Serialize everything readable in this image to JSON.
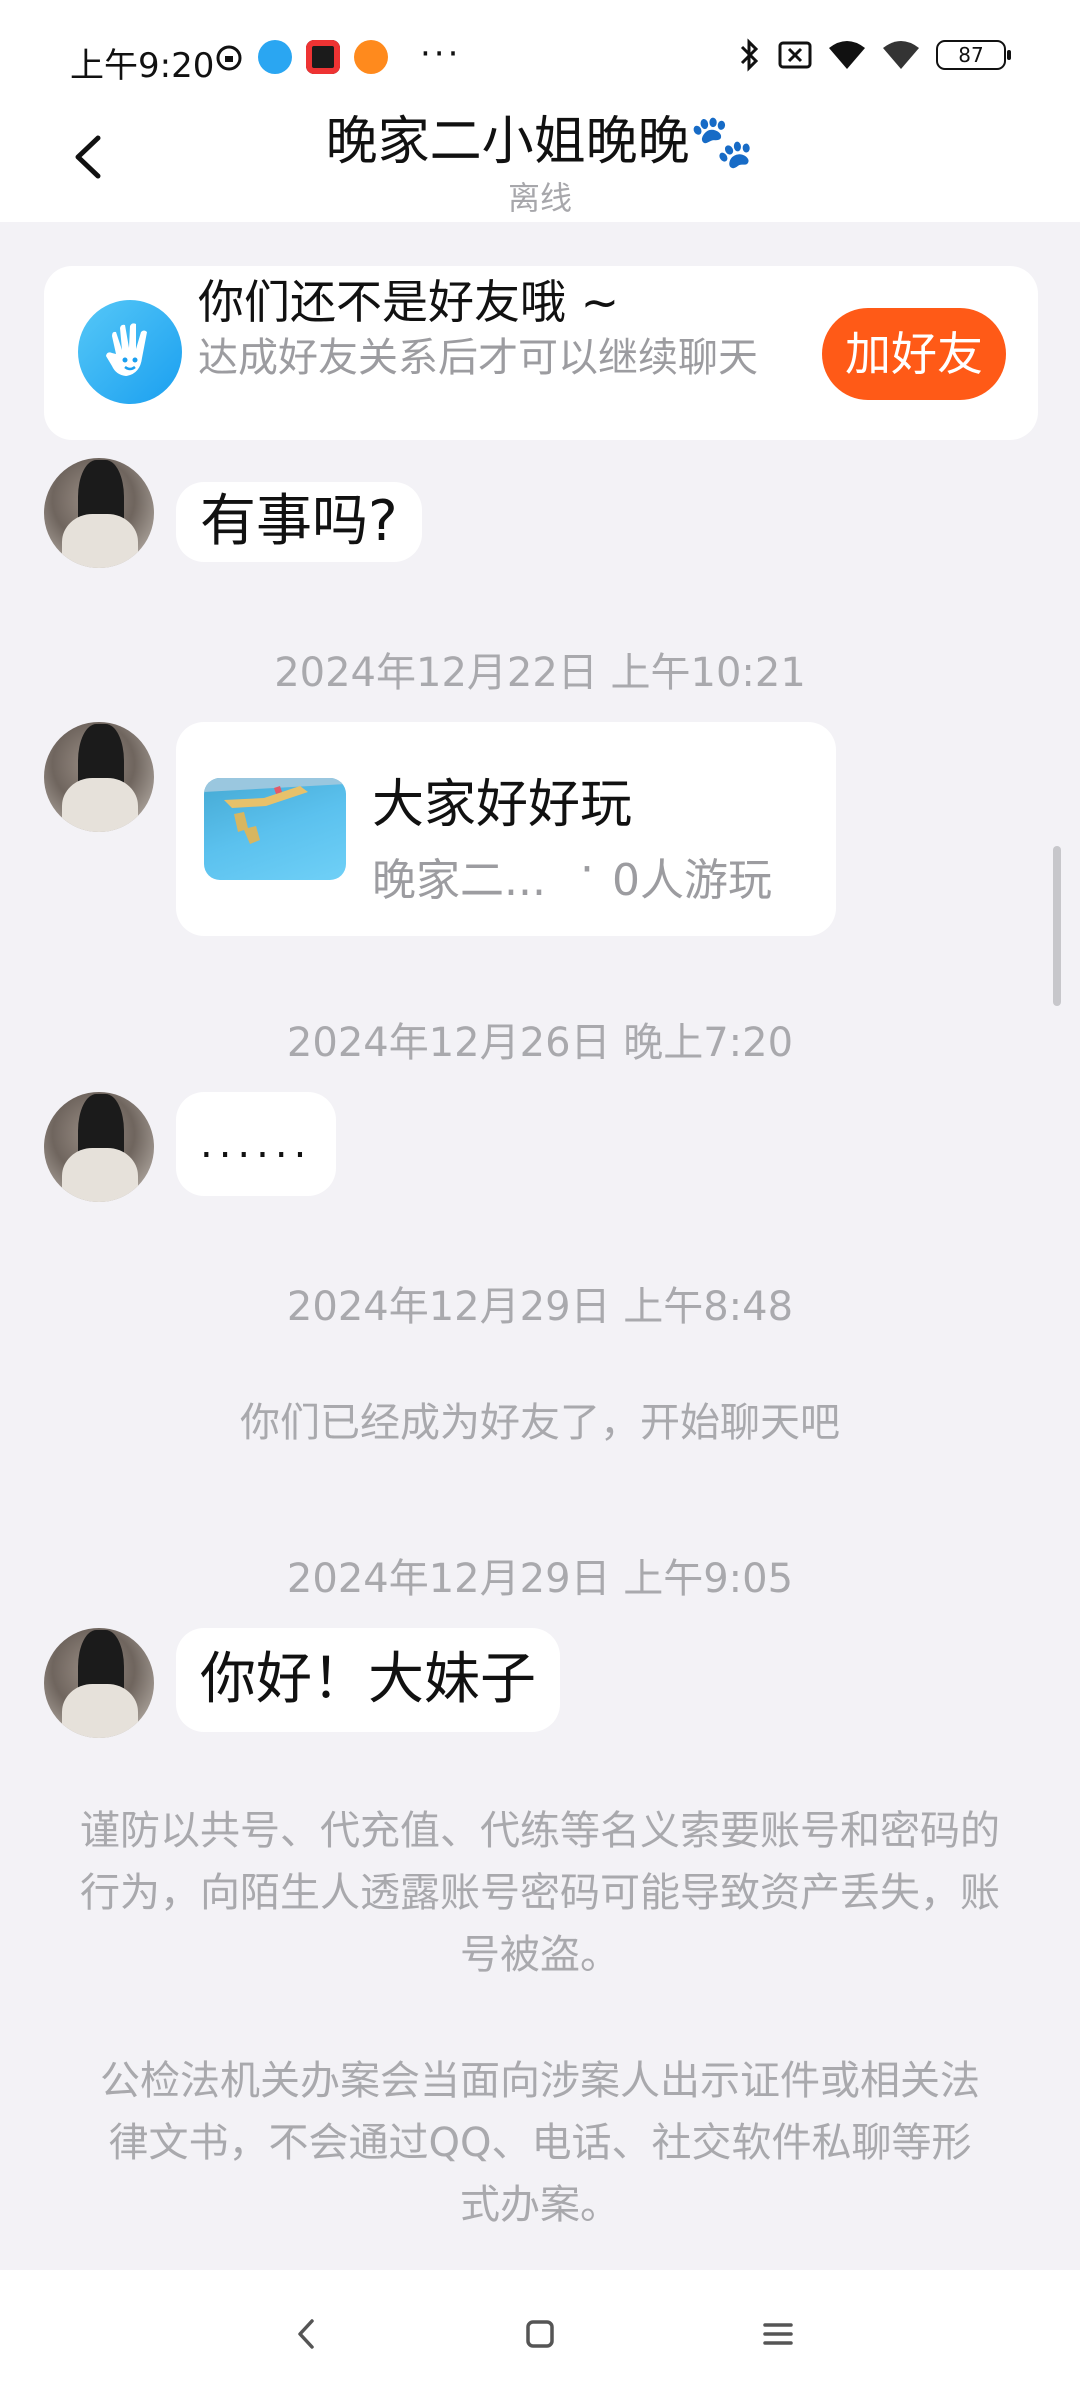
{
  "status_bar": {
    "time": "上午9:20",
    "more": "···",
    "battery": "87"
  },
  "header": {
    "title": "晚家二小姐晚晚🐾",
    "subtitle": "离线"
  },
  "friend_banner": {
    "title": "你们还不是好友哦 ~",
    "description": "达成好友关系后才可以继续聊天",
    "button": "加好友"
  },
  "messages": [
    {
      "type": "text",
      "text": "有事吗?"
    },
    {
      "type": "timestamp",
      "text": "2024年12月22日 上午10:21"
    },
    {
      "type": "card",
      "title": "大家好好玩",
      "author": "晚家二...",
      "dot": "·",
      "players": "0人游玩"
    },
    {
      "type": "timestamp",
      "text": "2024年12月26日 晚上7:20"
    },
    {
      "type": "text",
      "text": "......"
    },
    {
      "type": "timestamp",
      "text": "2024年12月29日 上午8:48"
    },
    {
      "type": "system",
      "text": "你们已经成为好友了，开始聊天吧"
    },
    {
      "type": "timestamp",
      "text": "2024年12月29日 上午9:05"
    },
    {
      "type": "text",
      "text": "你好！大妹子"
    }
  ],
  "warnings": {
    "account": "谨防以共号、代充值、代练等名义索要账号和密码的行为，向陌生人透露账号密码可能导致资产丢失，账号被盗。",
    "police": "公检法机关办案会当面向涉案人出示证件或相关法律文书，不会通过QQ、电话、社交软件私聊等形式办案。"
  },
  "colors": {
    "accent": "#ff5a17",
    "background": "#f3f2f6",
    "muted_text": "#a9a9ad",
    "icon_blue": "#1a9ff0"
  }
}
